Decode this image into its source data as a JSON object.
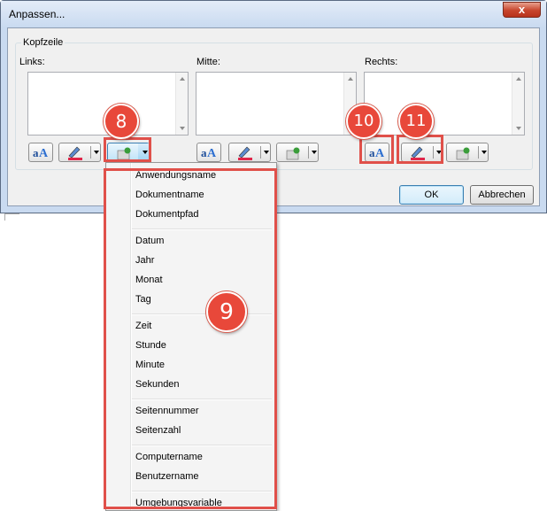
{
  "window": {
    "title": "Anpassen...",
    "close_glyph": "x"
  },
  "group": {
    "label": "Kopfzeile"
  },
  "columns": [
    {
      "label": "Links:"
    },
    {
      "label": "Mitte:"
    },
    {
      "label": "Rechts:"
    }
  ],
  "toolbar": {
    "font_icon_text": "aA",
    "font_icon": "font-format-icon",
    "color_icon": "pen-color-icon",
    "field_icon": "insert-field-icon"
  },
  "buttons": {
    "ok": "OK",
    "cancel": "Abbrechen"
  },
  "menu": {
    "items": [
      "Anwendungsname",
      "Dokumentname",
      "Dokumentpfad",
      "Datum",
      "Jahr",
      "Monat",
      "Tag",
      "Zeit",
      "Stunde",
      "Minute",
      "Sekunden",
      "Seitennummer",
      "Seitenzahl",
      "Computername",
      "Benutzername",
      "Umgebungsvariable"
    ]
  },
  "callouts": [
    "8",
    "9",
    "10",
    "11"
  ],
  "colors": {
    "callout_red": "#e8483a",
    "highlight_border": "#e0504a",
    "title_bg": "#c9daf0"
  }
}
